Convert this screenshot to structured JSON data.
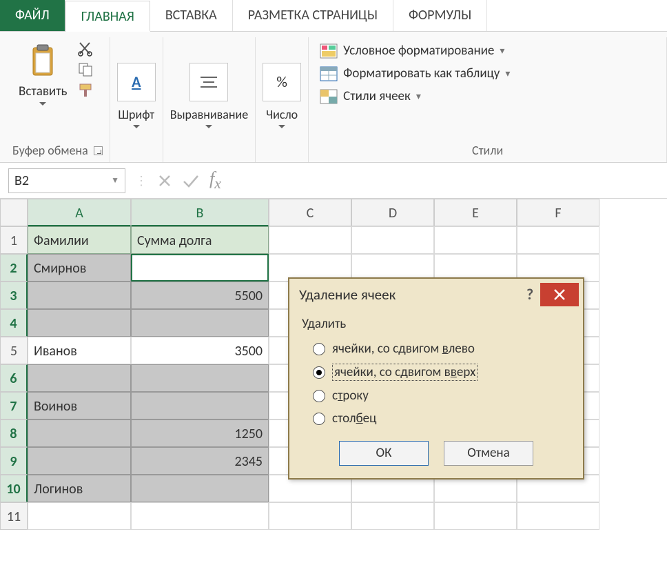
{
  "tabs": {
    "file": "ФАЙЛ",
    "home": "ГЛАВНАЯ",
    "insert": "ВСТАВКА",
    "layout": "РАЗМЕТКА СТРАНИЦЫ",
    "formulas": "ФОРМУЛЫ"
  },
  "ribbon": {
    "clipboard": {
      "paste": "Вставить",
      "group": "Буфер обмена"
    },
    "font": {
      "label": "Шрифт"
    },
    "align": {
      "label": "Выравнивание"
    },
    "number": {
      "label": "Число",
      "sample": "%"
    },
    "styles": {
      "cond": "Условное форматирование",
      "table": "Форматировать как таблицу",
      "cell": "Стили ячеек",
      "group": "Стили"
    }
  },
  "namebox": "B2",
  "cols": [
    "A",
    "B",
    "C",
    "D",
    "E",
    "F"
  ],
  "rows": {
    "header": {
      "a": "Фамилии",
      "b": "Сумма долга"
    },
    "r1": {
      "a": "Смирнов",
      "b": ""
    },
    "r2": {
      "a": "",
      "b": "5500"
    },
    "r3": {
      "a": "",
      "b": ""
    },
    "r4": {
      "a": "Иванов",
      "b": "3500"
    },
    "r5": {
      "a": "",
      "b": ""
    },
    "r6": {
      "a": "Воинов",
      "b": ""
    },
    "r7": {
      "a": "",
      "b": "1250"
    },
    "r8": {
      "a": "",
      "b": "2345"
    },
    "r9": {
      "a": "Логинов",
      "b": ""
    }
  },
  "dialog": {
    "title": "Удаление ячеек",
    "section": "Удалить",
    "opt_left": "ячейки, со сдвигом влево",
    "opt_left_u": "в",
    "opt_up": "ячейки, со сдвигом вверх",
    "opt_up_u": "в",
    "opt_row": "строку",
    "opt_row_u": "т",
    "opt_col": "столбец",
    "opt_col_u": "б",
    "ok": "ОК",
    "cancel": "Отмена"
  }
}
